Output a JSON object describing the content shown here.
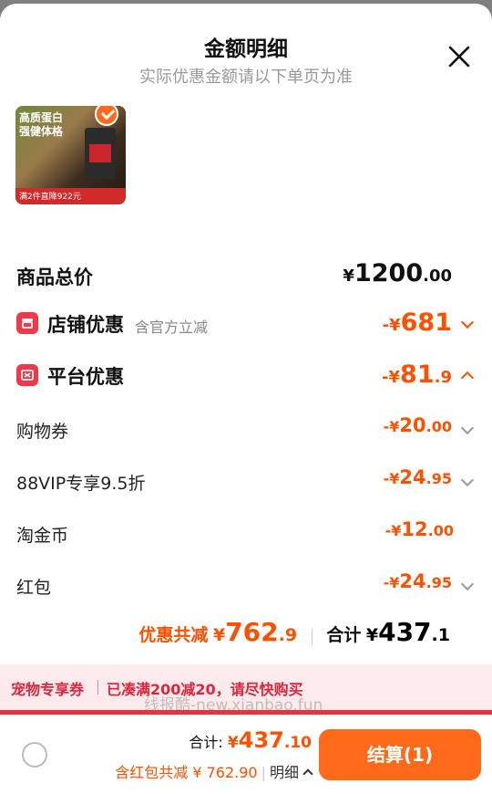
{
  "header": {
    "title": "金额明细",
    "subtitle": "实际优惠金额请以下单页为准"
  },
  "product": {
    "image_text_1": "高质蛋白",
    "image_text_2": "强健体格",
    "image_bar_text": "满2件直降922元"
  },
  "rows": {
    "goods_total": {
      "label": "商品总价",
      "sym": "¥",
      "int": "1200",
      "dec": ".00"
    },
    "shop_discount": {
      "label": "店铺优惠",
      "note": "含官方立减",
      "sym": "-¥",
      "int": "681",
      "dec": ""
    },
    "platform_discount": {
      "label": "平台优惠",
      "sym": "-¥",
      "int": "81",
      "dec": ".9"
    },
    "shopping_coupon": {
      "label": "购物券",
      "sym": "-¥",
      "int": "20",
      "dec": ".00"
    },
    "vip": {
      "label": "88VIP专享9.5折",
      "sym": "-¥",
      "int": "24",
      "dec": ".95"
    },
    "taojinbi": {
      "label": "淘金币",
      "sym": "-¥",
      "int": "12",
      "dec": ".00"
    },
    "hongbao": {
      "label": "红包",
      "sym": "-¥",
      "int": "24",
      "dec": ".95"
    }
  },
  "summary": {
    "discount_label": "优惠共减",
    "discount_sym": "¥",
    "discount_int": "762",
    "discount_dec": ".9",
    "total_label": "合计",
    "total_sym": "¥",
    "total_int": "437",
    "total_dec": ".1"
  },
  "coupon_bar": {
    "tag": "宠物专享券",
    "message": "已凑满200减20，请尽快购买"
  },
  "watermark": "线报酷-new.xianbao.fun",
  "footer": {
    "total_label": "合计:",
    "total_sym": "¥",
    "total_int": "437",
    "total_dec": ".10",
    "sub_text": "含红包共减 ¥ 762.90",
    "detail_label": "明细",
    "checkout_label": "结算(1)"
  },
  "colors": {
    "accent": "#ff5000",
    "checkout": "#ff6a1a",
    "coupon_bg": "#fdeaec",
    "coupon_text": "#e0243a"
  }
}
